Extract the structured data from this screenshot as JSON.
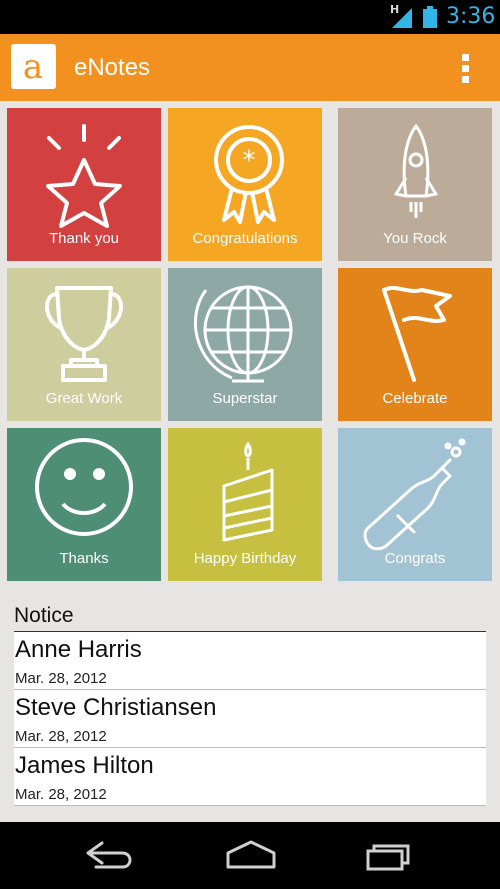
{
  "status_bar": {
    "network_label": "H",
    "time": "3:36",
    "icons": [
      "signal-icon",
      "battery-icon"
    ]
  },
  "action_bar": {
    "logo_letter": "a",
    "title": "eNotes",
    "menu_icon": "overflow-menu-icon"
  },
  "colors": {
    "action_bar": "#f39120",
    "thank_you": "#d2403f",
    "congratulations": "#f5a623",
    "you_rock": "#bbab98",
    "great_work": "#cdcd9e",
    "superstar": "#8da8a5",
    "celebrate": "#e2841a",
    "thanks": "#4e8e74",
    "happy_birthday": "#c7bf3f",
    "congrats": "#a1c3d4"
  },
  "tiles": [
    {
      "label": "Thank you",
      "icon": "star-icon"
    },
    {
      "label": "Congratulations",
      "icon": "ribbon-icon"
    },
    {
      "label": "You Rock",
      "icon": "rocket-icon"
    },
    {
      "label": "Great Work",
      "icon": "trophy-icon"
    },
    {
      "label": "Superstar",
      "icon": "globe-icon"
    },
    {
      "label": "Celebrate",
      "icon": "flag-icon"
    },
    {
      "label": "Thanks",
      "icon": "smiley-icon"
    },
    {
      "label": "Happy Birthday",
      "icon": "cake-icon"
    },
    {
      "label": "Congrats",
      "icon": "champagne-icon"
    }
  ],
  "notice": {
    "header": "Notice",
    "items": [
      {
        "name": "Anne Harris",
        "date": "Mar. 28, 2012"
      },
      {
        "name": "Steve Christiansen",
        "date": "Mar. 28, 2012"
      },
      {
        "name": "James Hilton",
        "date": "Mar. 28, 2012"
      }
    ]
  },
  "nav_bar": {
    "buttons": [
      "back-icon",
      "home-icon",
      "recent-apps-icon"
    ]
  }
}
